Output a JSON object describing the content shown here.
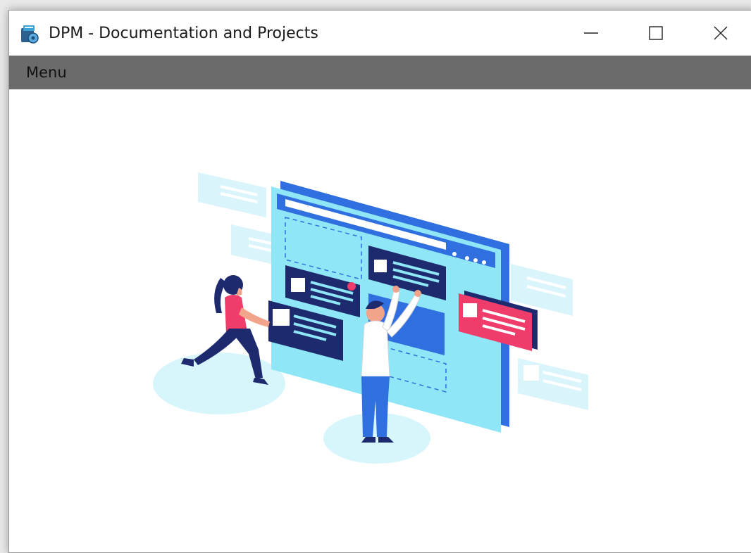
{
  "window": {
    "title": "DPM - Documentation and Projects",
    "app_icon": "dpm-app-icon",
    "controls": {
      "minimize_icon": "minimize-icon",
      "maximize_icon": "maximize-icon",
      "close_icon": "close-icon"
    }
  },
  "menubar": {
    "items": [
      {
        "label": "Menu"
      }
    ]
  },
  "main": {
    "illustration": "team-collaboration-web-layout-illustration"
  },
  "colors": {
    "menubar_bg": "#6b6b6b",
    "accent_blue": "#2f6fe0",
    "light_cyan": "#8fe6f6",
    "navy": "#1e2a6e",
    "pink": "#ef3c6a"
  }
}
